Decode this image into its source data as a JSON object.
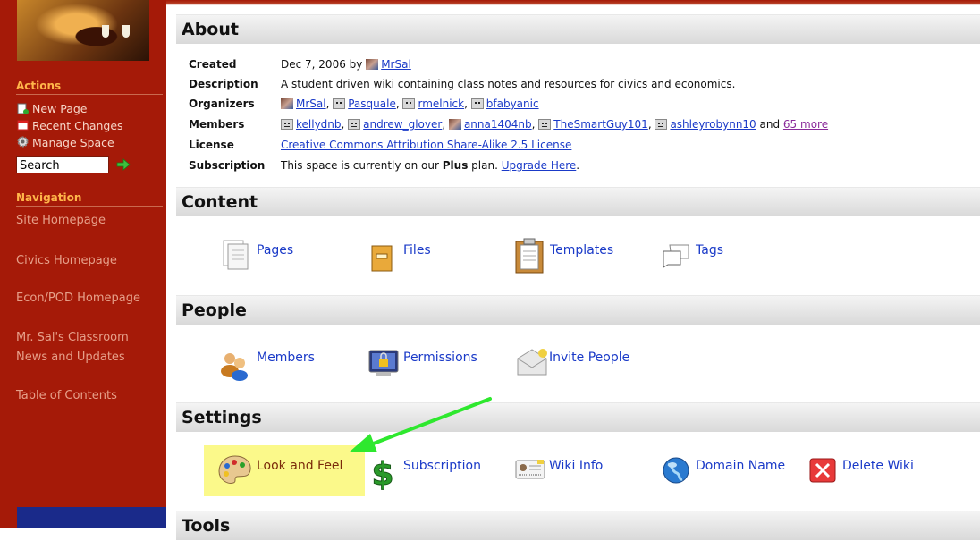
{
  "sidebar": {
    "actions_heading": "Actions",
    "actions": [
      {
        "label": "New Page",
        "icon": "new-page-icon"
      },
      {
        "label": "Recent Changes",
        "icon": "calendar-icon"
      },
      {
        "label": "Manage Space",
        "icon": "gear-icon"
      }
    ],
    "search_value": "Search",
    "navigation_heading": "Navigation",
    "nav_links": [
      "Site Homepage",
      "Civics Homepage",
      "Econ/POD Homepage",
      "Mr. Sal's Classroom",
      "News and Updates",
      "Table of Contents"
    ]
  },
  "about": {
    "title": "About",
    "created_label": "Created",
    "created_text": "Dec 7, 2006 by ",
    "created_user": "MrSal",
    "description_label": "Description",
    "description": "A student driven wiki containing class notes and resources for civics and economics.",
    "organizers_label": "Organizers",
    "organizers": [
      "MrSal",
      "Pasquale",
      "rmelnick",
      "bfabyanic"
    ],
    "members_label": "Members",
    "members": [
      "kellydnb",
      "andrew_glover",
      "anna1404nb",
      "TheSmartGuy101",
      "ashleyrobynn10"
    ],
    "members_and": " and ",
    "members_more": "65 more",
    "license_label": "License",
    "license": "Creative Commons Attribution Share-Alike 2.5 License",
    "subscription_label": "Subscription",
    "subscription_pre": "This space is currently on our ",
    "subscription_plan": "Plus",
    "subscription_post": " plan. ",
    "subscription_link": "Upgrade Here",
    "subscription_end": "."
  },
  "content": {
    "title": "Content",
    "items": [
      {
        "label": "Pages",
        "icon": "pages-icon"
      },
      {
        "label": "Files",
        "icon": "files-icon"
      },
      {
        "label": "Templates",
        "icon": "templates-icon"
      },
      {
        "label": "Tags",
        "icon": "tags-icon"
      }
    ]
  },
  "people": {
    "title": "People",
    "items": [
      {
        "label": "Members",
        "icon": "members-icon"
      },
      {
        "label": "Permissions",
        "icon": "permissions-icon"
      },
      {
        "label": "Invite People",
        "icon": "invite-icon"
      }
    ]
  },
  "settings": {
    "title": "Settings",
    "items": [
      {
        "label": "Look and Feel",
        "icon": "palette-icon"
      },
      {
        "label": "Subscription",
        "icon": "dollar-icon"
      },
      {
        "label": "Wiki Info",
        "icon": "id-card-icon"
      },
      {
        "label": "Domain Name",
        "icon": "globe-icon"
      },
      {
        "label": "Delete Wiki",
        "icon": "delete-icon"
      }
    ]
  },
  "tools": {
    "title": "Tools"
  },
  "colors": {
    "sidebar": "#a51a08",
    "link": "#1a3ac8",
    "highlight": "#fbf98a",
    "arrow": "#2ee82e"
  }
}
